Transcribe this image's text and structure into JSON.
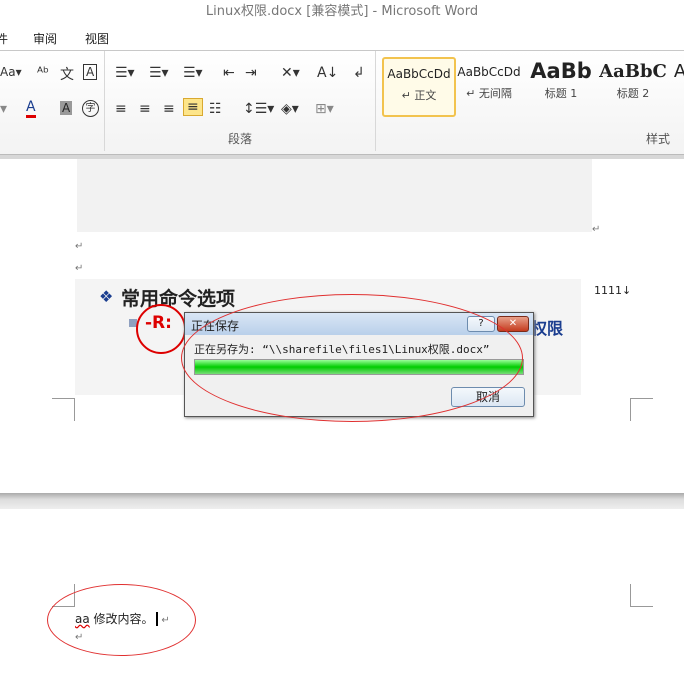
{
  "window": {
    "title": "Linux权限.docx [兼容模式]  -  Microsoft Word"
  },
  "tabs": [
    {
      "label": "件"
    },
    {
      "label": "审阅"
    },
    {
      "label": "视图"
    }
  ],
  "ribbon": {
    "groups": {
      "paragraph": "段落",
      "styles": "样式"
    },
    "styles": [
      {
        "preview": "AaBbCcDd",
        "name": "↵ 正文",
        "selected": true
      },
      {
        "preview": "AaBbCcDd",
        "name": "↵ 无间隔"
      },
      {
        "preview": "AaBb",
        "name": "标题 1"
      },
      {
        "preview": "AaBbC",
        "name": "标题 2"
      },
      {
        "preview": "A",
        "name": ""
      }
    ]
  },
  "document": {
    "slide": {
      "heading": "常用命令选项",
      "option": "-R:",
      "trailing": "权限"
    },
    "side_text": "1111↓",
    "para_mark": "↵",
    "page2_text_a": "aa",
    "page2_text_b": " 修改内容。"
  },
  "dialog": {
    "title": "正在保存",
    "help": "?",
    "close": "✕",
    "message": "正在另存为: “\\\\sharefile\\files1\\Linux权限.docx”",
    "progress": 1.0,
    "cancel": "取消"
  },
  "colors": {
    "annotation": "#e03030",
    "progress": "#00c000"
  }
}
